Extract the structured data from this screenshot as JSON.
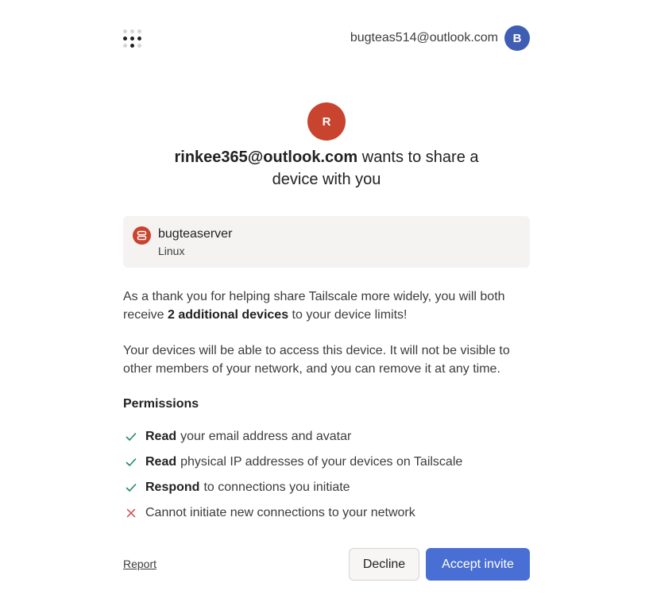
{
  "header": {
    "account_email": "bugteas514@outlook.com",
    "account_initial": "B",
    "logo_icon": "tailscale-logo-icon"
  },
  "invite": {
    "sender_initial": "R",
    "sender_email": "rinkee365@outlook.com",
    "headline_rest": " wants to share a device with you"
  },
  "device": {
    "icon": "server-icon",
    "name": "bugteaserver",
    "os": "Linux"
  },
  "body": {
    "p1_before": "As a thank you for helping share Tailscale more widely, you will both receive ",
    "p1_bold": "2 additional devices",
    "p1_after": " to your device limits!",
    "p2": "Your devices will be able to access this device. It will not be visible to other members of your network, and you can remove it at any time."
  },
  "permissions": {
    "title": "Permissions",
    "items": [
      {
        "icon": "check-icon",
        "verb": "Read",
        "text": "your email address and avatar"
      },
      {
        "icon": "check-icon",
        "verb": "Read",
        "text": "physical IP addresses of your devices on Tailscale"
      },
      {
        "icon": "check-icon",
        "verb": "Respond",
        "text": "to connections you initiate"
      },
      {
        "icon": "x-icon",
        "verb": "",
        "text": "Cannot initiate new connections to your network"
      }
    ]
  },
  "footer": {
    "report_label": "Report",
    "decline_label": "Decline",
    "accept_label": "Accept invite"
  },
  "colors": {
    "accent_blue": "#4a6fd4",
    "avatar_blue": "#3f5db3",
    "sender_red": "#c8442f",
    "check_green": "#1f8a5b",
    "cross_red": "#d2474b"
  }
}
